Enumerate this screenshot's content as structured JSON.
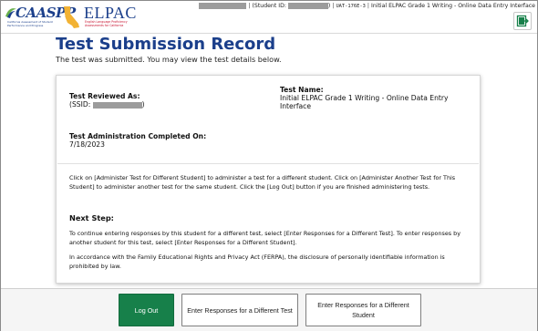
{
  "header": {
    "caaspp": {
      "word": "CAASPP",
      "tagline": "California Assessment of Student Performance and Progress"
    },
    "elpac": {
      "word": "ELPAC",
      "tagline": "English Language Proficiency Assessments for California"
    },
    "session": {
      "student_id_label": "(Student ID:",
      "student_id_close": ")",
      "session_code": "UAT-176E-3",
      "test_name": "Initial ELPAC Grade 1 Writing - Online Data Entry Interface"
    },
    "exit_icon": "exit-door-icon"
  },
  "page": {
    "title": "Test Submission Record",
    "subtitle": "The test was submitted. You may view the test details below."
  },
  "card": {
    "reviewed_label": "Test Reviewed As:",
    "ssid_prefix": "(SSID:",
    "ssid_suffix": ")",
    "test_name_label": "Test Name:",
    "test_name_value": "Initial ELPAC Grade 1 Writing - Online Data Entry Interface",
    "completed_label": "Test Administration Completed On:",
    "completed_value": "7/18/2023",
    "instructions": "Click on [Administer Test for Different Student] to administer a test for a different student. Click on [Administer Another Test for This Student] to administer another test for the same student. Click the [Log Out] button if you are finished administering tests.",
    "next_step_heading": "Next Step:",
    "next_step_text": "To continue entering responses by this student for a different test, select [Enter Responses for a Different Test]. To enter responses by another student for this test, select [Enter Responses for a Different Student].",
    "ferpa_text": "In accordance with the Family Educational Rights and Privacy Act (FERPA), the disclosure of personally identifiable information is prohibited by law."
  },
  "footer": {
    "logout_label": "Log Out",
    "diff_test_label": "Enter Responses for a Different Test",
    "diff_student_label": "Enter Responses for a Different Student"
  },
  "colors": {
    "title_blue": "#1b3f8b",
    "logout_green": "#17804a",
    "elpac_red": "#c8102e"
  }
}
